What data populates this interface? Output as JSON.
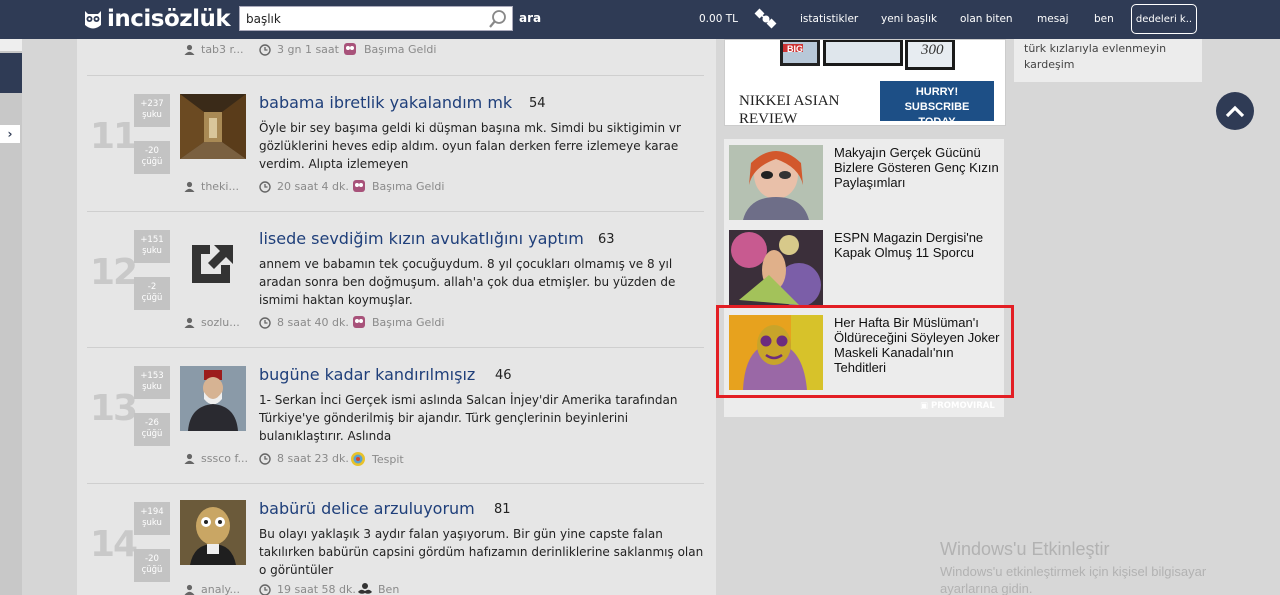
{
  "header": {
    "logo_text": "incisözlük",
    "search_value": "başlık",
    "search_button": "ara",
    "balance": "0.00 TL",
    "nav": [
      "istatistikler",
      "yeni başlık",
      "olan biten",
      "mesaj",
      "ben"
    ],
    "user_button": "dedeleri k.."
  },
  "first_meta": {
    "author": "tab3 r...",
    "time": "3 gn 1 saat",
    "category": "Başıma Geldi"
  },
  "entries": [
    {
      "rank": "11",
      "up": "+237",
      "up_label": "şuku",
      "down": "-20",
      "down_label": "çüğü",
      "title": "babama ibretlik yakalandım mk",
      "count": "54",
      "text": "Öyle bir sey başıma geldi ki düşman başına mk. Simdi bu siktigimin vr gözlüklerini heves edip aldım. oyun falan derken ferre izlemeye karae verdim. Alıpta izlemeyen",
      "author": "theki...",
      "time": "20 saat 4 dk.",
      "category": "Başıma Geldi"
    },
    {
      "rank": "12",
      "up": "+151",
      "up_label": "şuku",
      "down": "-2",
      "down_label": "çüğü",
      "title": "lisede sevdiğim kızın avukatlığını yaptım",
      "count": "63",
      "text": "annem ve babamın tek çocuğuydum. 8 yıl çocukları olmamış ve 8 yıl aradan sonra ben doğmuşum. allah'a çok dua etmişler. bu yüzden de ismimi haktan koymuşlar.",
      "author": "sozlu...",
      "time": "8 saat 40 dk.",
      "category": "Başıma Geldi"
    },
    {
      "rank": "13",
      "up": "+153",
      "up_label": "şuku",
      "down": "-26",
      "down_label": "çüğü",
      "title": "bugüne kadar kandırılmışız",
      "count": "46",
      "text": "1- Serkan İnci Gerçek ismi aslında Salcan İnjey'dir Amerika tarafından Türkiye'ye gönderilmiş bir ajandır. Türk gençlerinin beyinlerini bulanıklaştırır. Aslında",
      "author": "sssco f...",
      "time": "8 saat 23 dk.",
      "category": "Tespit"
    },
    {
      "rank": "14",
      "up": "+194",
      "up_label": "şuku",
      "down": "-20",
      "down_label": "çüğü",
      "title": "babürü delice arzuluyorum",
      "count": "81",
      "text": "Bu olayı yaklaşık 3 aydır falan yaşıyorum. Bir gün yine capste falan takılırken babürün capsini gördüm hafızamın derinliklerine saklanmış olan o görüntüler",
      "author": "analy...",
      "time": "19 saat 58 dk.",
      "category": "Ben"
    }
  ],
  "ad": {
    "brand": "NIKKEI ASIAN REVIEW",
    "cta": "HURRY! SUBSCRIBE TODAY",
    "tag1": "BIG",
    "tag2": "300"
  },
  "promo": {
    "items": [
      {
        "title": "Makyajın Gerçek Gücünü Bizlere Gösteren Genç Kızın Paylaşımları"
      },
      {
        "title": "ESPN Magazin Dergisi'ne Kapak Olmuş 11 Sporcu"
      },
      {
        "title": "Her Hafta Bir Müslüman'ı Öldüreceğini Söyleyen Joker Maskeli Kanadalı'nın Tehditleri"
      }
    ],
    "label": "PROMOVIRAL"
  },
  "side_card": {
    "text": "türk kızlarıyla evlenmeyin kardeşim"
  },
  "watermark": {
    "title": "Windows'u Etkinleştir",
    "subtitle": "Windows'u etkinleştirmek için kişisel bilgisayar ayarlarına gidin."
  },
  "colors": {
    "topbar": "#2f3b55",
    "link": "#1f3f7a",
    "highlight": "#e31e24"
  }
}
